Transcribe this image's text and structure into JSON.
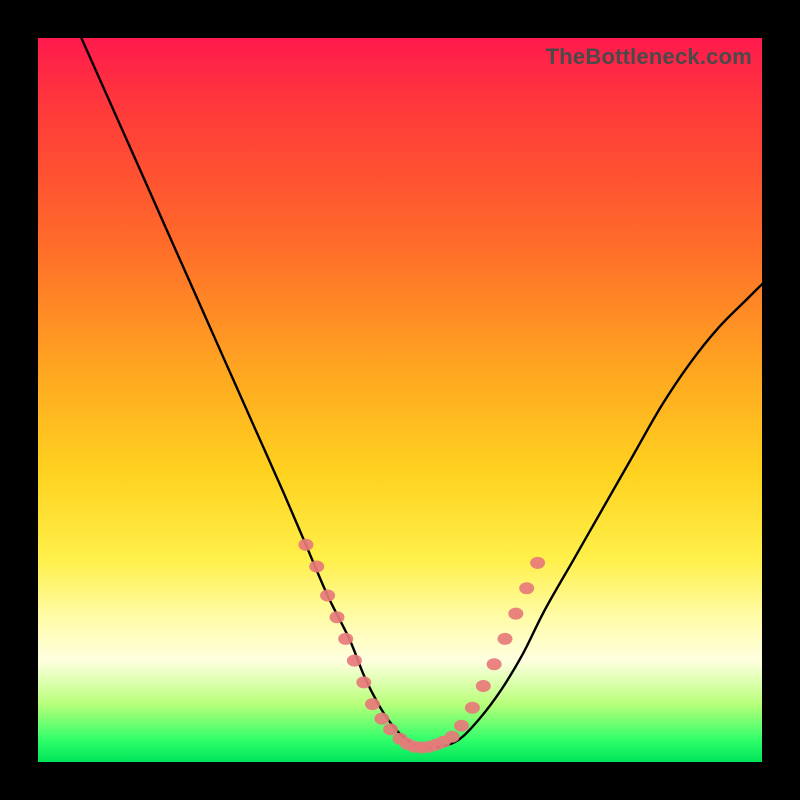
{
  "watermark": "TheBottleneck.com",
  "chart_data": {
    "type": "line",
    "title": "",
    "xlabel": "",
    "ylabel": "",
    "xlim": [
      0,
      100
    ],
    "ylim": [
      0,
      100
    ],
    "series": [
      {
        "name": "bottleneck-curve",
        "x": [
          6,
          10,
          14,
          18,
          22,
          26,
          30,
          34,
          37,
          40,
          43,
          45,
          47,
          49,
          51,
          53,
          55,
          58,
          61,
          64,
          67,
          70,
          74,
          78,
          82,
          86,
          90,
          94,
          98,
          100
        ],
        "values": [
          100,
          91,
          82,
          73,
          64,
          55,
          46,
          37,
          30,
          23,
          17,
          12,
          8,
          5,
          3,
          2,
          2,
          3,
          6,
          10,
          15,
          21,
          28,
          35,
          42,
          49,
          55,
          60,
          64,
          66
        ]
      }
    ],
    "markers": {
      "name": "highlight-dots",
      "color": "#e77a7a",
      "points": [
        {
          "x": 37,
          "y": 30
        },
        {
          "x": 38.5,
          "y": 27
        },
        {
          "x": 40,
          "y": 23
        },
        {
          "x": 41.3,
          "y": 20
        },
        {
          "x": 42.5,
          "y": 17
        },
        {
          "x": 43.7,
          "y": 14
        },
        {
          "x": 45,
          "y": 11
        },
        {
          "x": 46.2,
          "y": 8
        },
        {
          "x": 47.5,
          "y": 6
        },
        {
          "x": 48.7,
          "y": 4.5
        },
        {
          "x": 50,
          "y": 3.2
        },
        {
          "x": 51,
          "y": 2.5
        },
        {
          "x": 52,
          "y": 2.1
        },
        {
          "x": 53,
          "y": 2
        },
        {
          "x": 54,
          "y": 2.1
        },
        {
          "x": 55,
          "y": 2.4
        },
        {
          "x": 56,
          "y": 2.8
        },
        {
          "x": 57.2,
          "y": 3.5
        },
        {
          "x": 58.5,
          "y": 5
        },
        {
          "x": 60,
          "y": 7.5
        },
        {
          "x": 61.5,
          "y": 10.5
        },
        {
          "x": 63,
          "y": 13.5
        },
        {
          "x": 64.5,
          "y": 17
        },
        {
          "x": 66,
          "y": 20.5
        },
        {
          "x": 67.5,
          "y": 24
        },
        {
          "x": 69,
          "y": 27.5
        }
      ]
    }
  }
}
